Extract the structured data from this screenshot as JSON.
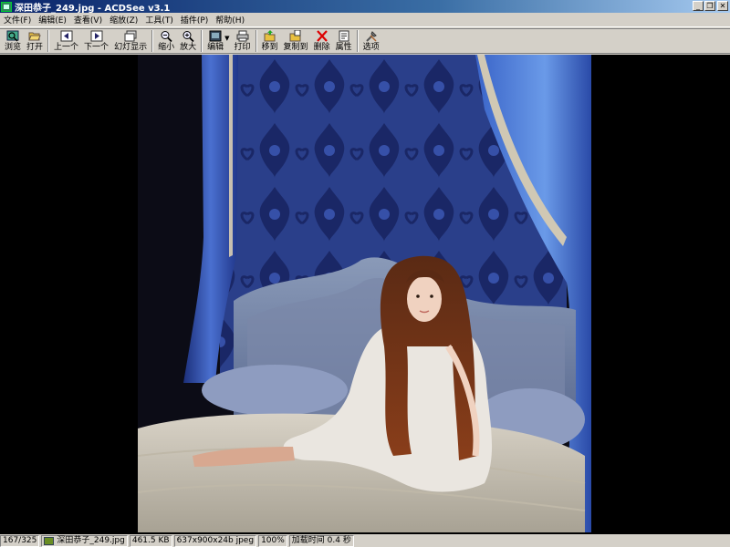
{
  "window": {
    "title": "深田恭子_249.jpg - ACDSee v3.1"
  },
  "menu": [
    {
      "label": "文件(F)"
    },
    {
      "label": "编辑(E)"
    },
    {
      "label": "查看(V)"
    },
    {
      "label": "缩放(Z)"
    },
    {
      "label": "工具(T)"
    },
    {
      "label": "插件(P)"
    },
    {
      "label": "帮助(H)"
    }
  ],
  "toolbar": {
    "browse": "浏览",
    "open": "打开",
    "prev": "上一个",
    "next": "下一个",
    "slideshow": "幻灯显示",
    "zoom_out": "缩小",
    "zoom_in": "放大",
    "edit": "编辑",
    "print": "打印",
    "move_to": "移到",
    "copy_to": "复制到",
    "delete": "删除",
    "properties": "属性",
    "options": "选项"
  },
  "status": {
    "position": "167/325",
    "filename": "深田恭子_249.jpg",
    "filesize": "461.5 KB",
    "dimensions": "637x900x24b jpeg",
    "zoom": "100%",
    "load_time": "加载时间 0.4 秒"
  },
  "colors": {
    "titlebar_start": "#0a246a",
    "titlebar_end": "#a6caf0",
    "chrome": "#d4d0c8",
    "viewer_bg": "#000000"
  }
}
